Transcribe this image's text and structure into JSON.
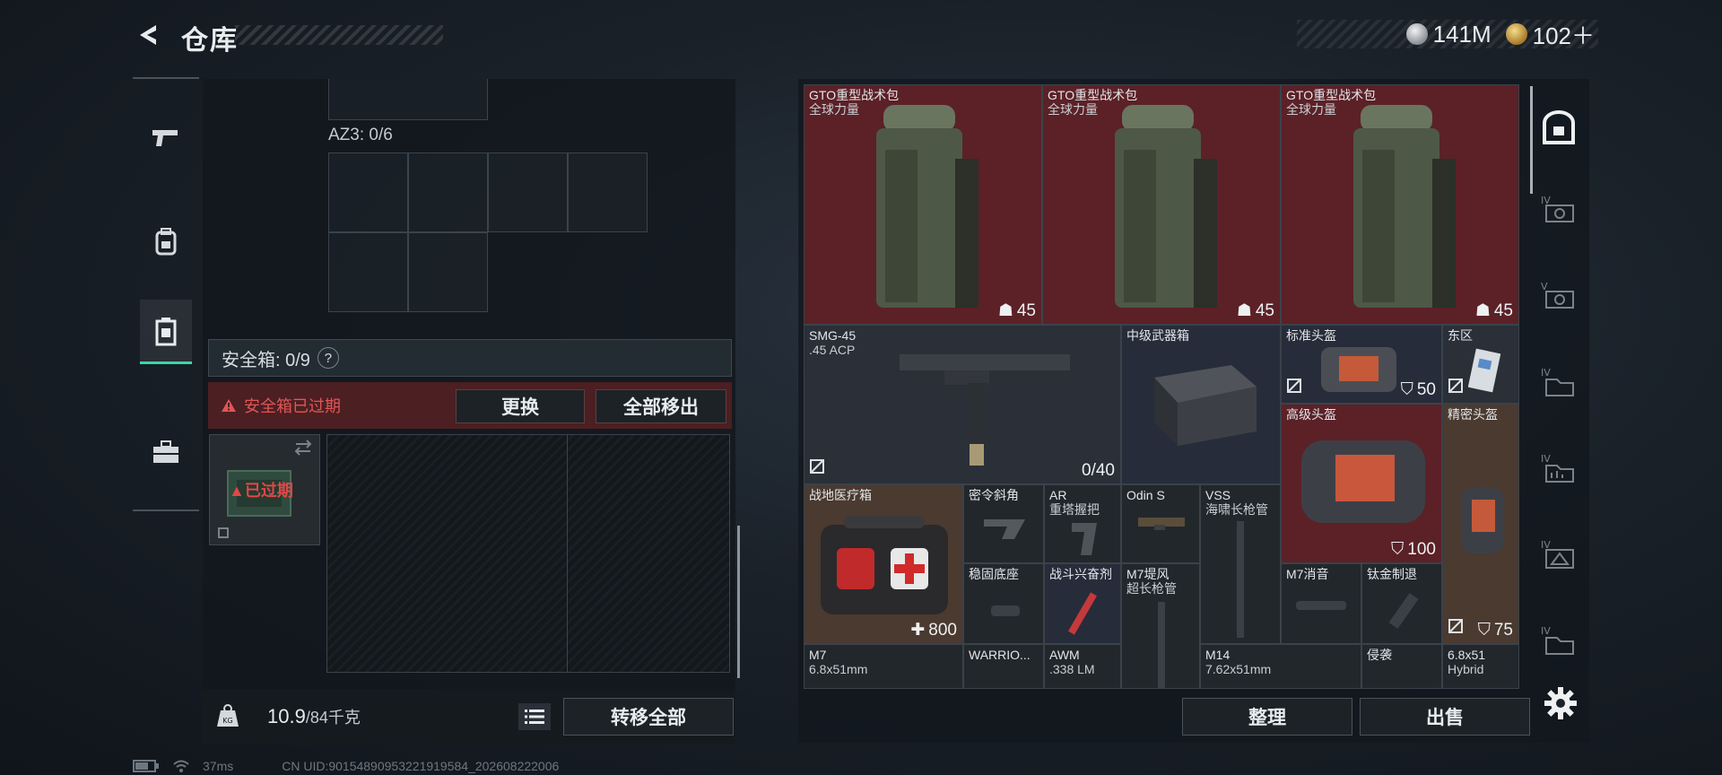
{
  "header": {
    "title": "仓库",
    "currency": [
      {
        "icon": "silver-coin-icon",
        "value": "141M"
      },
      {
        "icon": "gold-coin-icon",
        "value": "102＋"
      }
    ]
  },
  "left_nav": [
    "weapon-icon",
    "backpack-icon",
    "safe-box-icon",
    "toolbox-icon"
  ],
  "left": {
    "az3_label": "AZ3: 0/6",
    "safe_box_label": "安全箱: 0/9",
    "help": "?",
    "expired_warning": "安全箱已过期",
    "replace_btn": "更换",
    "remove_all_btn": "全部移出",
    "case_status": "已过期",
    "weight_value": "10.9",
    "weight_max": "/84千克",
    "transfer_all_btn": "转移全部"
  },
  "items": [
    {
      "name": "GTO重型战术包",
      "sub": "全球力量",
      "value": "45"
    },
    {
      "name": "GTO重型战术包",
      "sub": "全球力量",
      "value": "45"
    },
    {
      "name": "GTO重型战术包",
      "sub": "全球力量",
      "value": "45"
    },
    {
      "name": "SMG-45",
      "sub": ".45 ACP",
      "value": "0/40"
    },
    {
      "name": "中级武器箱",
      "sub": "",
      "value": ""
    },
    {
      "name": "标准头盔",
      "sub": "",
      "value": "50"
    },
    {
      "name": "东区",
      "sub": "",
      "value": ""
    },
    {
      "name": "高级头盔",
      "sub": "",
      "value": "100"
    },
    {
      "name": "精密头盔",
      "sub": "",
      "value": "75"
    },
    {
      "name": "战地医疗箱",
      "sub": "",
      "value": "800"
    },
    {
      "name": "密令斜角",
      "sub": "",
      "value": ""
    },
    {
      "name": "AR",
      "sub": "重塔握把",
      "value": ""
    },
    {
      "name": "Odin S",
      "sub": "",
      "value": ""
    },
    {
      "name": "VSS",
      "sub": "海啸长枪管",
      "value": ""
    },
    {
      "name": "稳固底座",
      "sub": "",
      "value": ""
    },
    {
      "name": "战斗兴奋剂",
      "sub": "",
      "value": ""
    },
    {
      "name": "M7堤风",
      "sub": "超长枪管",
      "value": ""
    },
    {
      "name": "M7消音",
      "sub": "",
      "value": ""
    },
    {
      "name": "钛金制退",
      "sub": "",
      "value": ""
    },
    {
      "name": "M7",
      "sub": "6.8x51mm",
      "value": ""
    },
    {
      "name": "WARRIO...",
      "sub": "",
      "value": ""
    },
    {
      "name": "AWM",
      "sub": ".338 LM",
      "value": ""
    },
    {
      "name": "M14",
      "sub": "7.62x51mm",
      "value": ""
    },
    {
      "name": "侵袭",
      "sub": "",
      "value": ""
    },
    {
      "name": "6.8x51",
      "sub": "Hybrid",
      "value": ""
    }
  ],
  "right_bottom": {
    "sort_btn": "整理",
    "sell_btn": "出售"
  },
  "categories": [
    {
      "icon": "all-items-icon",
      "label": ""
    },
    {
      "icon": "category-iv-icon",
      "label": "IV"
    },
    {
      "icon": "category-v-icon",
      "label": "V"
    },
    {
      "icon": "category-iv-icon",
      "label": "IV"
    },
    {
      "icon": "category-iv-icon",
      "label": "IV"
    },
    {
      "icon": "category-iv-icon",
      "label": "IV"
    },
    {
      "icon": "category-iv-icon",
      "label": "IV"
    }
  ],
  "status": {
    "ping": "37ms",
    "uid": "CN UID:90154890953221919584_202608222006"
  },
  "colors": {
    "accent": "#3ad6a8",
    "warning": "#e05656",
    "red_rarity": "#5b2127"
  }
}
